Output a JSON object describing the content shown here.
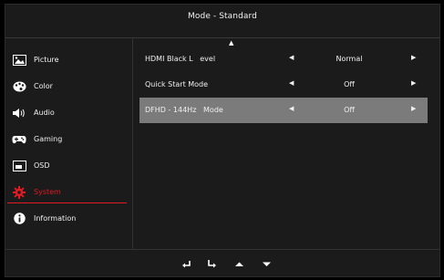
{
  "window": {
    "title": "Mode - Standard"
  },
  "sidebar": {
    "items": [
      {
        "label": "Picture",
        "icon": "picture-icon",
        "active": false
      },
      {
        "label": "Color",
        "icon": "palette-icon",
        "active": false
      },
      {
        "label": "Audio",
        "icon": "speaker-icon",
        "active": false
      },
      {
        "label": "Gaming",
        "icon": "gamepad-icon",
        "active": false
      },
      {
        "label": "OSD",
        "icon": "osd-icon",
        "active": false
      },
      {
        "label": "System",
        "icon": "gear-icon",
        "active": true
      },
      {
        "label": "Information",
        "icon": "info-icon",
        "active": false
      }
    ]
  },
  "settings": {
    "rows": [
      {
        "label": "HDMI Black L   evel",
        "value": "Normal",
        "selected": false
      },
      {
        "label": "Quick Start Mode",
        "value": "Off",
        "selected": false
      },
      {
        "label": "DFHD - 144Hz   Mode",
        "value": "Off",
        "selected": true
      }
    ]
  },
  "colors": {
    "accent": "#e21b23",
    "selected_row": "#7b7b7b",
    "panel": "#1b1b1b"
  },
  "nav_icons": [
    "back-icon",
    "enter-icon",
    "up-icon",
    "down-icon"
  ]
}
